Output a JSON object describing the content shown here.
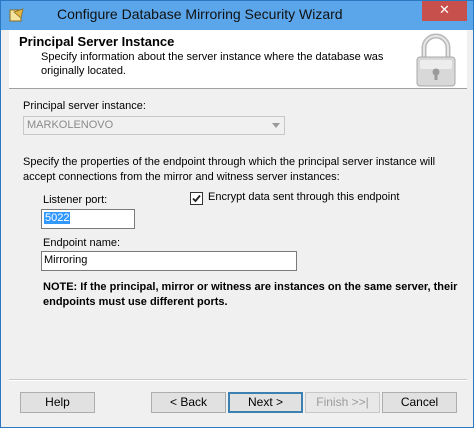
{
  "window": {
    "title": "Configure Database Mirroring Security Wizard",
    "close_glyph": "✕"
  },
  "header": {
    "title": "Principal Server Instance",
    "description": "Specify information about the server instance where the database was originally located.",
    "icon": "padlock-icon"
  },
  "principal": {
    "label": "Principal server instance:",
    "value": "MARKOLENOVO"
  },
  "endpoint": {
    "description": "Specify the properties of the endpoint through which the principal server instance will accept connections from the mirror and witness server instances:",
    "port_label": "Listener port:",
    "port_value": "5022",
    "encrypt_label": "Encrypt data sent through this endpoint",
    "encrypt_checked": true,
    "name_label": "Endpoint name:",
    "name_value": "Mirroring",
    "note": "NOTE: If the principal, mirror or witness are instances on the same server, their endpoints must use different ports."
  },
  "buttons": {
    "help": "Help",
    "back": "< Back",
    "next": "Next >",
    "finish": "Finish >>|",
    "cancel": "Cancel"
  },
  "colors": {
    "titlebar": "#5ba6ea",
    "close": "#c7504c",
    "selection": "#3399ff"
  }
}
